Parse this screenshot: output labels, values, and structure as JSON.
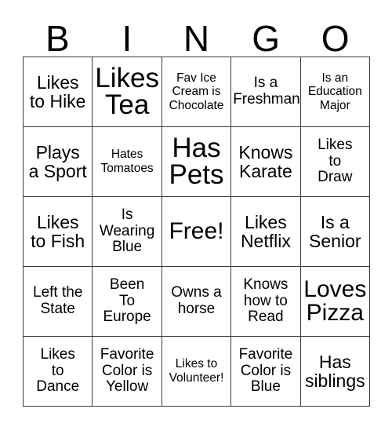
{
  "card": {
    "title_letters": [
      "B",
      "I",
      "N",
      "G",
      "O"
    ],
    "grid_size": "5x5",
    "border_color": "#3b3b3b",
    "background_color": "#ffffff",
    "text_color": "#000000"
  },
  "squares": [
    [
      {
        "text": "Likes\nto Hike",
        "size": "md"
      },
      {
        "text": "Likes\nTea",
        "size": "xl"
      },
      {
        "text": "Fav Ice\nCream is\nChocolate",
        "size": "xs"
      },
      {
        "text": "Is a\nFreshman",
        "size": "sm"
      },
      {
        "text": "Is an\nEducation\nMajor",
        "size": "xs"
      }
    ],
    [
      {
        "text": "Plays\na Sport",
        "size": "md"
      },
      {
        "text": "Hates\nTomatoes",
        "size": "xs"
      },
      {
        "text": "Has\nPets",
        "size": "xl"
      },
      {
        "text": "Knows\nKarate",
        "size": "md"
      },
      {
        "text": "Likes\nto\nDraw",
        "size": "sm"
      }
    ],
    [
      {
        "text": "Likes\nto Fish",
        "size": "md"
      },
      {
        "text": "Is\nWearing\nBlue",
        "size": "sm"
      },
      {
        "text": "Free!",
        "size": "lg"
      },
      {
        "text": "Likes\nNetflix",
        "size": "md"
      },
      {
        "text": "Is a\nSenior",
        "size": "md"
      }
    ],
    [
      {
        "text": "Left the\nState",
        "size": "sm"
      },
      {
        "text": "Been\nTo\nEurope",
        "size": "sm"
      },
      {
        "text": "Owns a\nhorse",
        "size": "sm"
      },
      {
        "text": "Knows\nhow to\nRead",
        "size": "sm"
      },
      {
        "text": "Loves\nPizza",
        "size": "lg"
      }
    ],
    [
      {
        "text": "Likes\nto\nDance",
        "size": "sm"
      },
      {
        "text": "Favorite\nColor is\nYellow",
        "size": "sm"
      },
      {
        "text": "Likes to\nVolunteer!",
        "size": "xs"
      },
      {
        "text": "Favorite\nColor is\nBlue",
        "size": "sm"
      },
      {
        "text": "Has\nsiblings",
        "size": "md"
      }
    ]
  ]
}
